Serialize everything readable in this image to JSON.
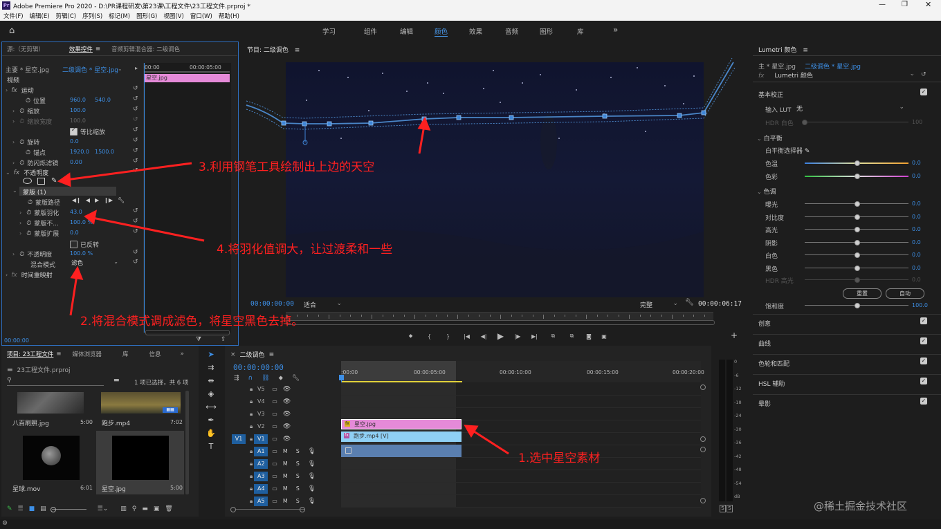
{
  "titlebar": {
    "app_badge": "Pr",
    "title": "Adobe Premiere Pro 2020 - D:\\PR课程研发\\第23课\\工程文件\\23工程文件.prproj *"
  },
  "menu": [
    "文件(F)",
    "编辑(E)",
    "剪辑(C)",
    "序列(S)",
    "标记(M)",
    "图形(G)",
    "视图(V)",
    "窗口(W)",
    "帮助(H)"
  ],
  "workspaces": [
    "学习",
    "组件",
    "编辑",
    "颜色",
    "效果",
    "音频",
    "图形",
    "库"
  ],
  "workspace_active": "颜色",
  "more_glyph": "»",
  "effect_controls": {
    "tabs": [
      "源:（无剪辑）",
      "效果控件",
      "音频剪辑混合器: 二级调色"
    ],
    "master": "主要 * 星空.jpg",
    "clip": "二级调色 * 星空.jpg",
    "video_label": "视频",
    "ruler_start": "00:00",
    "ruler_end": "00:00:05:00",
    "clip_bar": "星空.jpg",
    "motion": "运动",
    "position_label": "位置",
    "position_x": "960.0",
    "position_y": "540.0",
    "scale_label": "缩放",
    "scale_value": "100.0",
    "scale_width_label": "缩放宽度",
    "scale_width_value": "100.0",
    "uniform_label": "等比缩放",
    "rotation_label": "旋转",
    "rotation_value": "0.0",
    "anchor_label": "锚点",
    "anchor_x": "1920.0",
    "anchor_y": "1500.0",
    "antiflicker_label": "防闪烁滤镜",
    "antiflicker_value": "0.00",
    "opacity_group": "不透明度",
    "mask_label": "蒙版 (1)",
    "mask_path_label": "蒙版路径",
    "mask_feather_label": "蒙版羽化",
    "mask_feather_value": "43.0",
    "mask_opacity_label": "蒙版不...",
    "mask_opacity_value": "100.0 %",
    "mask_expansion_label": "蒙版扩展",
    "mask_expansion_value": "0.0",
    "inverted_label": "已反转",
    "opacity_label": "不透明度",
    "opacity_value": "100.0 %",
    "blend_label": "混合模式",
    "blend_value": "滤色",
    "time_remap": "时间重映射",
    "timecode": "00:00:00"
  },
  "program": {
    "title": "节目: 二级调色",
    "timecode": "00:00:00:00",
    "fit": "适合",
    "quality": "完整",
    "duration": "00:00:06:17"
  },
  "lumetri": {
    "title": "Lumetri 颜色",
    "master": "主 * 星空.jpg",
    "clip": "二级调色 * 星空.jpg",
    "effect": "Lumetri 颜色",
    "basic": "基本校正",
    "input_lut_label": "输入 LUT",
    "input_lut_value": "无",
    "hdr_white_label": "HDR 白色",
    "hdr_white_value": "100",
    "wb_label": "白平衡",
    "wb_selector": "白平衡选择器",
    "temp_label": "色温",
    "temp_value": "0.0",
    "tint_label": "色彩",
    "tint_value": "0.0",
    "tone_label": "色调",
    "exposure_label": "曝光",
    "exposure_value": "0.0",
    "contrast_label": "对比度",
    "contrast_value": "0.0",
    "highlights_label": "高光",
    "highlights_value": "0.0",
    "shadows_label": "阴影",
    "shadows_value": "0.0",
    "whites_label": "白色",
    "whites_value": "0.0",
    "blacks_label": "黑色",
    "blacks_value": "0.0",
    "hdr_spec_label": "HDR 高光",
    "hdr_spec_value": "0.0",
    "reset_btn": "重置",
    "auto_btn": "自动",
    "saturation_label": "饱和度",
    "saturation_value": "100.0",
    "sections": [
      "创意",
      "曲线",
      "色轮和匹配",
      "HSL 辅助",
      "晕影"
    ]
  },
  "project": {
    "tabs": [
      "项目: 23工程文件",
      "媒体浏览器",
      "库",
      "信息"
    ],
    "file": "23工程文件.prproj",
    "selection_info": "1 项已选择，共 6 项",
    "items": [
      {
        "name": "八百刷照.jpg",
        "duration": "5:00"
      },
      {
        "name": "跑步.mp4",
        "duration": "7:02"
      },
      {
        "name": "星球.mov",
        "duration": "6:01"
      },
      {
        "name": "星空.jpg",
        "duration": "5:00"
      }
    ]
  },
  "timeline": {
    "tab": "二级调色",
    "timecode": "00:00:00:00",
    "ruler": [
      ":00:00",
      "00:00:05:00",
      "00:00:10:00",
      "00:00:15:00",
      "00:00:20:00"
    ],
    "video_tracks": [
      "V5",
      "V4",
      "V3",
      "V2",
      "V1"
    ],
    "audio_tracks": [
      "A1",
      "A2",
      "A3",
      "A4",
      "A5"
    ],
    "source_v": "V1",
    "mute_glyph": "M",
    "solo_glyph": "S",
    "clip_v2": "星空.jpg",
    "clip_v1": "跑步.mp4 [V]"
  },
  "meter_scale": [
    "0",
    "-6",
    "-12",
    "-18",
    "-24",
    "-30",
    "-36",
    "-42",
    "-48",
    "-54",
    "dB"
  ],
  "meter_bottom": [
    "S",
    "S"
  ],
  "annotations": {
    "a1": "1.选中星空素材",
    "a2": "2.将混合模式调成滤色，将星空黑色去掉。",
    "a3": "3.利用钢笔工具绘制出上边的天空",
    "a4": "4.将羽化值调大，让过渡柔和一些"
  },
  "watermark": "@稀土掘金技术社区",
  "colors": {
    "accent": "#3d8fe6",
    "annotation": "#ff2020",
    "clip_pink": "#e58ad8",
    "clip_blue": "#8fd0f5",
    "audio_clip": "#5a7fb0",
    "mask_path": "#4a86c8"
  }
}
